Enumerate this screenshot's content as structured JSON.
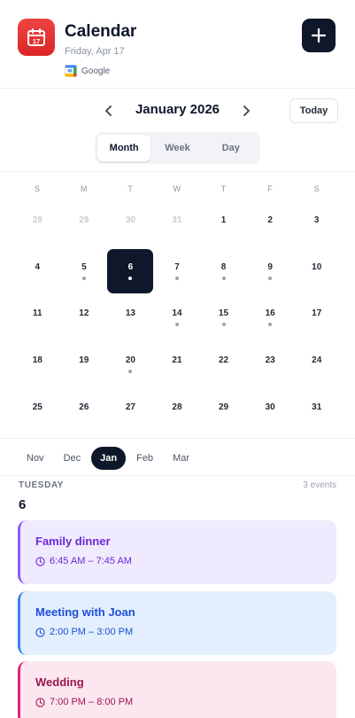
{
  "header": {
    "title": "Calendar",
    "date": "Friday, Apr 17",
    "icon_day": "17",
    "source_label": "Google"
  },
  "nav": {
    "month_title": "January 2026",
    "today_label": "Today"
  },
  "view_tabs": [
    {
      "label": "Month",
      "active": true
    },
    {
      "label": "Week",
      "active": false
    },
    {
      "label": "Day",
      "active": false
    }
  ],
  "weekdays": [
    "S",
    "M",
    "T",
    "W",
    "T",
    "F",
    "S"
  ],
  "days": [
    {
      "n": "28",
      "out": true,
      "dot": false
    },
    {
      "n": "29",
      "out": true,
      "dot": false
    },
    {
      "n": "30",
      "out": true,
      "dot": false
    },
    {
      "n": "31",
      "out": true,
      "dot": false
    },
    {
      "n": "1",
      "out": false,
      "dot": false
    },
    {
      "n": "2",
      "out": false,
      "dot": false
    },
    {
      "n": "3",
      "out": false,
      "dot": false
    },
    {
      "n": "4",
      "out": false,
      "dot": false
    },
    {
      "n": "5",
      "out": false,
      "dot": true
    },
    {
      "n": "6",
      "out": false,
      "dot": true,
      "selected": true
    },
    {
      "n": "7",
      "out": false,
      "dot": true
    },
    {
      "n": "8",
      "out": false,
      "dot": true
    },
    {
      "n": "9",
      "out": false,
      "dot": true
    },
    {
      "n": "10",
      "out": false,
      "dot": false
    },
    {
      "n": "11",
      "out": false,
      "dot": false
    },
    {
      "n": "12",
      "out": false,
      "dot": false
    },
    {
      "n": "13",
      "out": false,
      "dot": false
    },
    {
      "n": "14",
      "out": false,
      "dot": true
    },
    {
      "n": "15",
      "out": false,
      "dot": true
    },
    {
      "n": "16",
      "out": false,
      "dot": true
    },
    {
      "n": "17",
      "out": false,
      "dot": false
    },
    {
      "n": "18",
      "out": false,
      "dot": false
    },
    {
      "n": "19",
      "out": false,
      "dot": false
    },
    {
      "n": "20",
      "out": false,
      "dot": true
    },
    {
      "n": "21",
      "out": false,
      "dot": false
    },
    {
      "n": "22",
      "out": false,
      "dot": false
    },
    {
      "n": "23",
      "out": false,
      "dot": false
    },
    {
      "n": "24",
      "out": false,
      "dot": false
    },
    {
      "n": "25",
      "out": false,
      "dot": false
    },
    {
      "n": "26",
      "out": false,
      "dot": false
    },
    {
      "n": "27",
      "out": false,
      "dot": false
    },
    {
      "n": "28",
      "out": false,
      "dot": false
    },
    {
      "n": "29",
      "out": false,
      "dot": false
    },
    {
      "n": "30",
      "out": false,
      "dot": false
    },
    {
      "n": "31",
      "out": false,
      "dot": false
    }
  ],
  "month_chips": [
    {
      "label": "Nov",
      "active": false
    },
    {
      "label": "Dec",
      "active": false
    },
    {
      "label": "Jan",
      "active": true
    },
    {
      "label": "Feb",
      "active": false
    },
    {
      "label": "Mar",
      "active": false
    }
  ],
  "selected_day": {
    "weekday": "TUESDAY",
    "number": "6",
    "count": "3 events"
  },
  "events": [
    {
      "title": "Family dinner",
      "time": "6:45 AM – 7:45 AM",
      "bg": "#efeafd",
      "border": "#8b5cf6",
      "fg": "#6d28d9"
    },
    {
      "title": "Meeting with Joan",
      "time": "2:00 PM – 3:00 PM",
      "bg": "#e3effd",
      "border": "#3b82f6",
      "fg": "#1d4ed8"
    },
    {
      "title": "Wedding",
      "time": "7:00 PM – 8:00 PM",
      "bg": "#fce7f0",
      "border": "#db2777",
      "fg": "#9d174d"
    }
  ],
  "icons": {
    "app": "calendar-icon",
    "add": "plus-icon",
    "prev": "chevron-left-icon",
    "next": "chevron-right-icon",
    "source": "google-calendar-icon",
    "time": "clock-icon"
  }
}
